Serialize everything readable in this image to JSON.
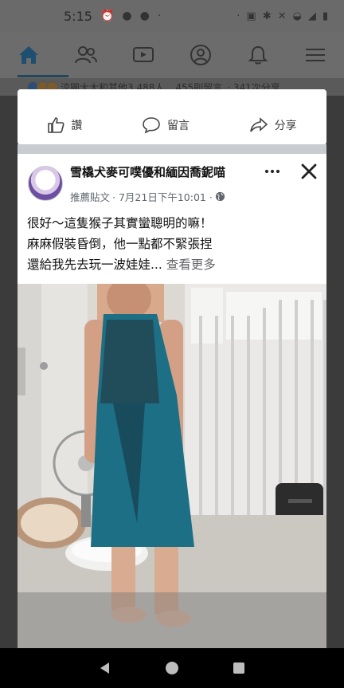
{
  "status_bar": {
    "time": "5:15"
  },
  "summary": {
    "reactions_text": "涼圓大大和其他3,488人",
    "comments_text": "455則留言",
    "shares_text": "· 341次分享"
  },
  "actions": {
    "like": "讚",
    "comment": "留言",
    "share": "分享"
  },
  "post": {
    "page_name": "雪橇犬麥可噗優和緬因喬鈮喵",
    "sponsored": "推薦貼文",
    "time": "· 7月21日下午10:01 ·",
    "lines": [
      "很好～這隻猴子其實蠻聰明的嘛！",
      "麻麻假裝昏倒，他一點都不緊張捏",
      "還給我先去玩一波娃娃..."
    ],
    "see_more": "查看更多"
  },
  "colors": {
    "fb_blue": "#1f4f70",
    "dim": "#6c6c6c",
    "dress": "#1d6f86"
  }
}
